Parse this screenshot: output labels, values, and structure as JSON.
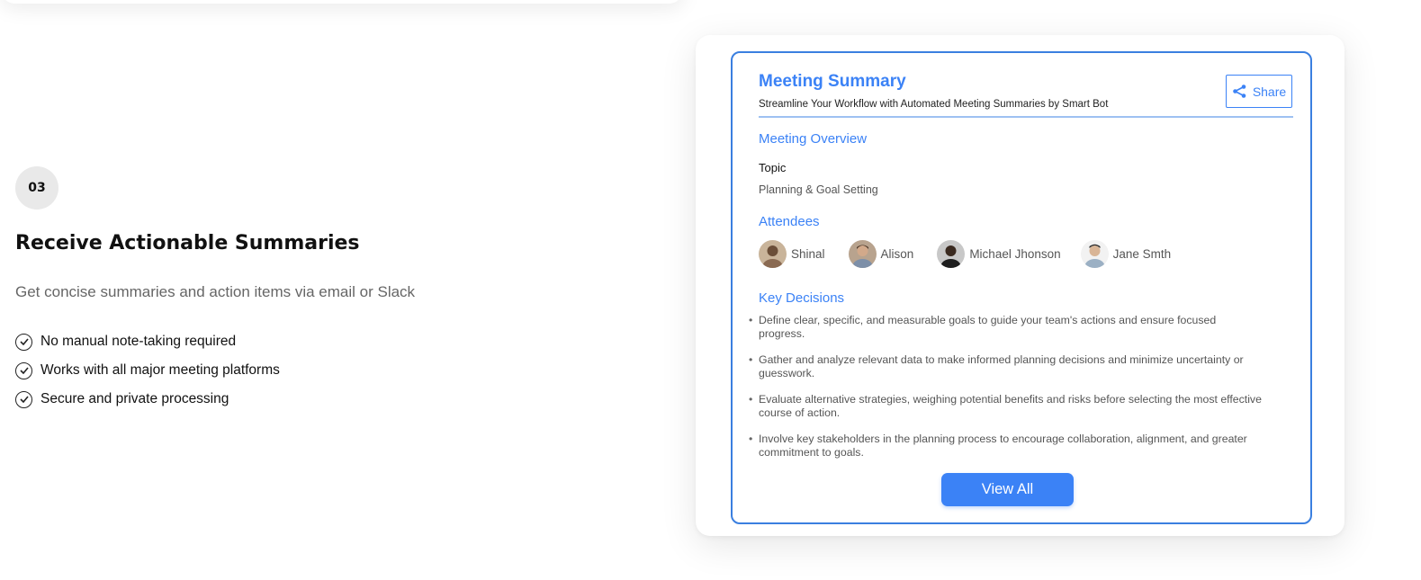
{
  "step": {
    "number": "03",
    "title": "Receive Actionable Summaries",
    "description": "Get concise summaries and action items via email or Slack",
    "features": [
      "No manual note-taking required",
      "Works with all major meeting platforms",
      "Secure and private processing"
    ]
  },
  "summary": {
    "title": "Meeting Summary",
    "subtitle": "Streamline Your Workflow with Automated Meeting Summaries by Smart Bot",
    "share_label": "Share",
    "overview_heading": "Meeting Overview",
    "topic_label": "Topic",
    "topic_value": "Planning & Goal Setting",
    "attendees_heading": "Attendees",
    "attendees": [
      "Shinal",
      "Alison",
      "Michael Jhonson",
      "Jane Smth"
    ],
    "decisions_heading": "Key Decisions",
    "decisions": [
      "Define clear, specific, and measurable goals to guide your team's actions and ensure focused progress.",
      "Gather and analyze relevant data to make informed planning decisions and minimize uncertainty or guesswork.",
      "Evaluate alternative strategies, weighing potential benefits and risks before selecting the most effective course of action.",
      "Involve key stakeholders in the planning process to encourage collaboration, alignment, and greater commitment to goals."
    ],
    "view_all_label": "View All"
  },
  "colors": {
    "accent": "#3b82f6",
    "badge_bg": "#e9e9e9",
    "muted_text": "#666666"
  },
  "icons": {
    "share": "share-icon",
    "check": "check-circle-icon",
    "avatar": "avatar"
  }
}
